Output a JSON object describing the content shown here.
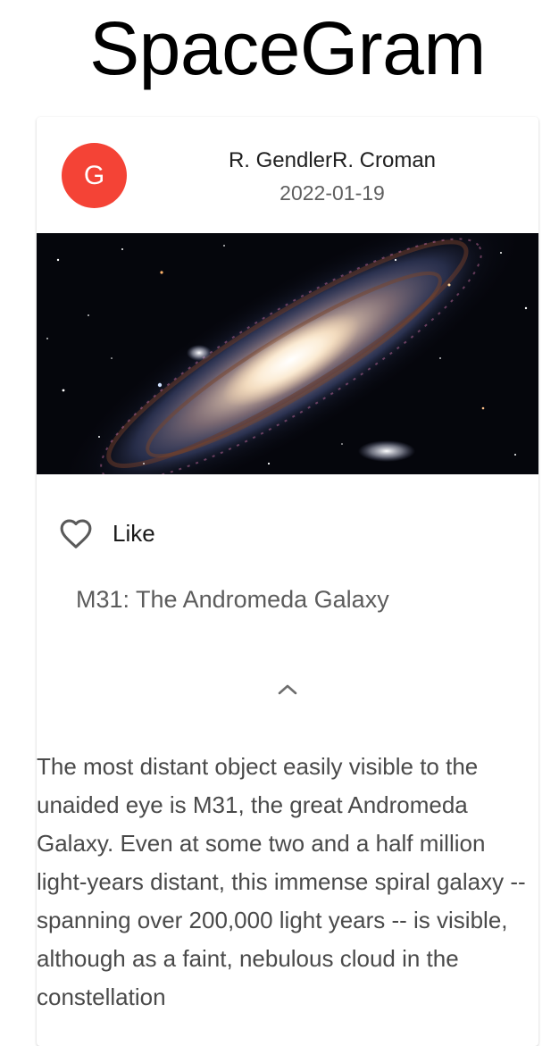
{
  "app": {
    "title": "SpaceGram"
  },
  "post": {
    "avatar_letter": "G",
    "author": "R. GendlerR. Croman",
    "date": "2022-01-19",
    "like_label": "Like",
    "title": "M31: The Andromeda Galaxy",
    "description": "The most distant object easily visible to the unaided eye is M31, the great Andromeda Galaxy. Even at some two and a half million light-years distant, this immense spiral galaxy -- spanning over 200,000 light years -- is visible, although as a faint, nebulous cloud in the constellation",
    "liked": false
  },
  "colors": {
    "avatar_bg": "#f44336",
    "sky": "#05060c"
  },
  "icons": {
    "like": "heart-outline-icon",
    "collapse": "chevron-up-icon"
  }
}
